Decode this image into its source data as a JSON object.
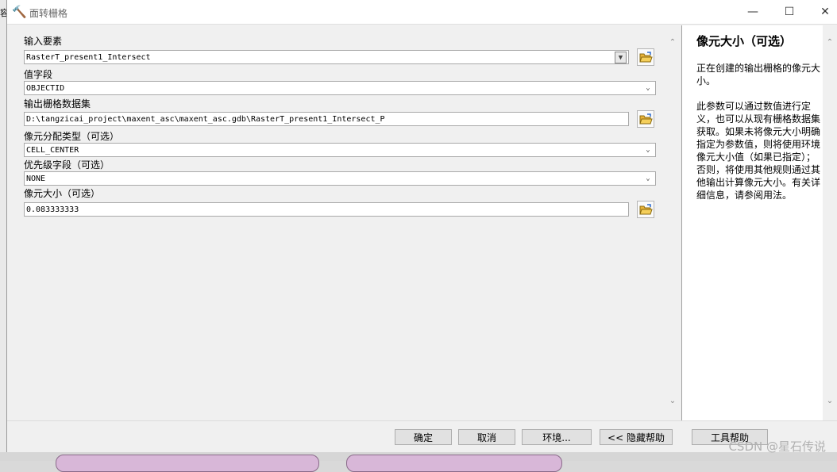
{
  "window": {
    "title": "面转栅格",
    "left_fragment": "容"
  },
  "fields": [
    {
      "label": "输入要素",
      "value": "RasterT_present1_Intersect"
    },
    {
      "label": "值字段",
      "value": "OBJECTID"
    },
    {
      "label": "输出栅格数据集",
      "value": "D:\\tangzicai_project\\maxent_asc\\maxent_asc.gdb\\RasterT_present1_Intersect_P"
    },
    {
      "label": "像元分配类型（可选）",
      "value": "CELL_CENTER"
    },
    {
      "label": "优先级字段（可选）",
      "value": "NONE"
    },
    {
      "label": "像元大小（可选）",
      "value": "0.083333333"
    }
  ],
  "help": {
    "title": "像元大小（可选）",
    "para1": "正在创建的输出栅格的像元大小。",
    "para2": "此参数可以通过数值进行定义，也可以从现有栅格数据集获取。如果未将像元大小明确指定为参数值，则将使用环境像元大小值（如果已指定）；否则，将使用其他规则通过其他输出计算像元大小。有关详细信息，请参阅用法。"
  },
  "buttons": {
    "ok": "确定",
    "cancel": "取消",
    "env": "环境...",
    "hide_help": "<< 隐藏帮助",
    "tool_help": "工具帮助"
  },
  "watermark": "CSDN @星石传说",
  "colors": {
    "folder": "#e8b339",
    "panel": "#f0f0f0"
  }
}
